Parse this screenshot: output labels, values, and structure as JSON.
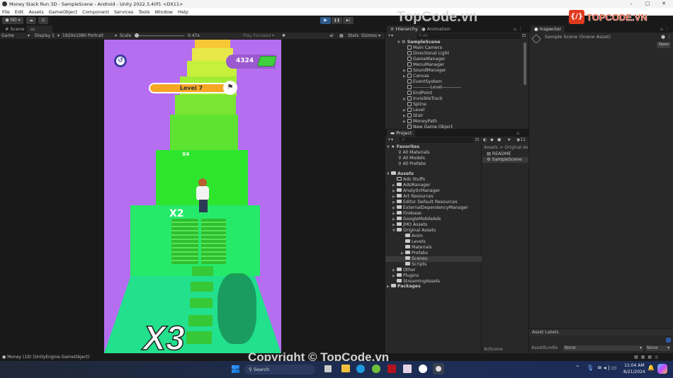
{
  "window": {
    "title": "Money Stack Run 3D - SampleScene - Android - Unity 2022.3.40f1 <DX11>",
    "controls": [
      "–",
      "▢",
      "✕"
    ]
  },
  "menu": [
    "File",
    "Edit",
    "Assets",
    "GameObject",
    "Component",
    "Services",
    "Tools",
    "Window",
    "Help"
  ],
  "toolbar": {
    "account": "ND",
    "play_icon": "▶",
    "pause_icon": "❚❚",
    "step_icon": "▶|"
  },
  "watermark": {
    "top": "TopCode.vn",
    "logo": "TOPCODE.VN",
    "bottom": "Copyright © TopCode.vn"
  },
  "game_panel": {
    "tabs": [
      "Scene",
      "Game"
    ],
    "active_tab": "Game",
    "mode": "Game",
    "display": "Display 1",
    "resolution": "1920x1080 Portrait",
    "scale_label": "Scale",
    "scale_value": "0.47x",
    "play_focused": "Play Focused",
    "stats": "Stats",
    "gizmos": "Gizmos"
  },
  "game": {
    "money": "4324",
    "level": "Level 7",
    "multiplier_near": "X3",
    "multiplier_far": "X4",
    "multiplier_mid": "X2",
    "colors": {
      "bg": "#b56ef0",
      "level_bar": "#f5a623",
      "money_badge": "#9b59d0"
    }
  },
  "hierarchy": {
    "tabs": [
      "Hierarchy",
      "Animation"
    ],
    "search_placeholder": "All",
    "scene": "SampleScene",
    "items": [
      {
        "label": "Main Camera",
        "expandable": false
      },
      {
        "label": "Directional Light",
        "expandable": false
      },
      {
        "label": "GameManager",
        "expandable": false
      },
      {
        "label": "MenuManager",
        "expandable": false
      },
      {
        "label": "SoundManager",
        "expandable": true
      },
      {
        "label": "Canvas",
        "expandable": true
      },
      {
        "label": "EventSystem",
        "expandable": false
      },
      {
        "label": "-----------Level------------",
        "expandable": false
      },
      {
        "label": "EndPoint",
        "expandable": false
      },
      {
        "label": "InvisibleTrack",
        "expandable": true
      },
      {
        "label": "Spline",
        "expandable": false
      },
      {
        "label": "Level",
        "expandable": true
      },
      {
        "label": "Stair",
        "expandable": true
      },
      {
        "label": "MoneyPath",
        "expandable": true
      },
      {
        "label": "New Game Object",
        "expandable": false
      }
    ]
  },
  "project": {
    "tab": "Project",
    "count_badge": "11",
    "favorites_label": "Favorites",
    "favorites": [
      "All Materials",
      "All Models",
      "All Prefabs"
    ],
    "assets_label": "Assets",
    "assets": [
      {
        "label": "Ads Stuffs",
        "depth": 1,
        "expandable": false,
        "open": false
      },
      {
        "label": "AdsManager",
        "depth": 1,
        "expandable": true
      },
      {
        "label": "AnalyticManager",
        "depth": 1,
        "expandable": true
      },
      {
        "label": "Art Resources",
        "depth": 1,
        "expandable": true
      },
      {
        "label": "Editor Default Resources",
        "depth": 1,
        "expandable": true
      },
      {
        "label": "ExternalDependencyManager",
        "depth": 1,
        "expandable": true
      },
      {
        "label": "Firebase",
        "depth": 1,
        "expandable": true
      },
      {
        "label": "GoogleMobileAds",
        "depth": 1,
        "expandable": true
      },
      {
        "label": "JMO Assets",
        "depth": 1,
        "expandable": true
      },
      {
        "label": "Original Assets",
        "depth": 1,
        "expandable": true,
        "open": true
      },
      {
        "label": "Anim",
        "depth": 2,
        "expandable": false
      },
      {
        "label": "Levels",
        "depth": 2,
        "expandable": false
      },
      {
        "label": "Materials",
        "depth": 2,
        "expandable": false
      },
      {
        "label": "Prefabs",
        "depth": 2,
        "expandable": true
      },
      {
        "label": "Scenes",
        "depth": 2,
        "expandable": false,
        "selected": true
      },
      {
        "label": "Scripts",
        "depth": 2,
        "expandable": false
      },
      {
        "label": "Other",
        "depth": 1,
        "expandable": true
      },
      {
        "label": "Plugins",
        "depth": 1,
        "expandable": true
      },
      {
        "label": "StreamingAssets",
        "depth": 1,
        "expandable": false
      }
    ],
    "packages_label": "Packages",
    "breadcrumb": "Assets > Original Asse",
    "files": [
      "README",
      "SampleScene"
    ],
    "footer_path": "/Scene"
  },
  "inspector": {
    "tab": "Inspector",
    "title": "Sample Scene (Scene Asset)",
    "open_button": "Open",
    "asset_labels": "Asset Labels",
    "asset_bundle_label": "AssetBundle",
    "asset_bundle_value": "None",
    "asset_variant_value": "None"
  },
  "status_bar": {
    "message": "Money (19) (UnityEngine.GameObject)"
  },
  "taskbar": {
    "search_placeholder": "Search",
    "time": "11:04 AM",
    "date": "8/21/2024"
  }
}
